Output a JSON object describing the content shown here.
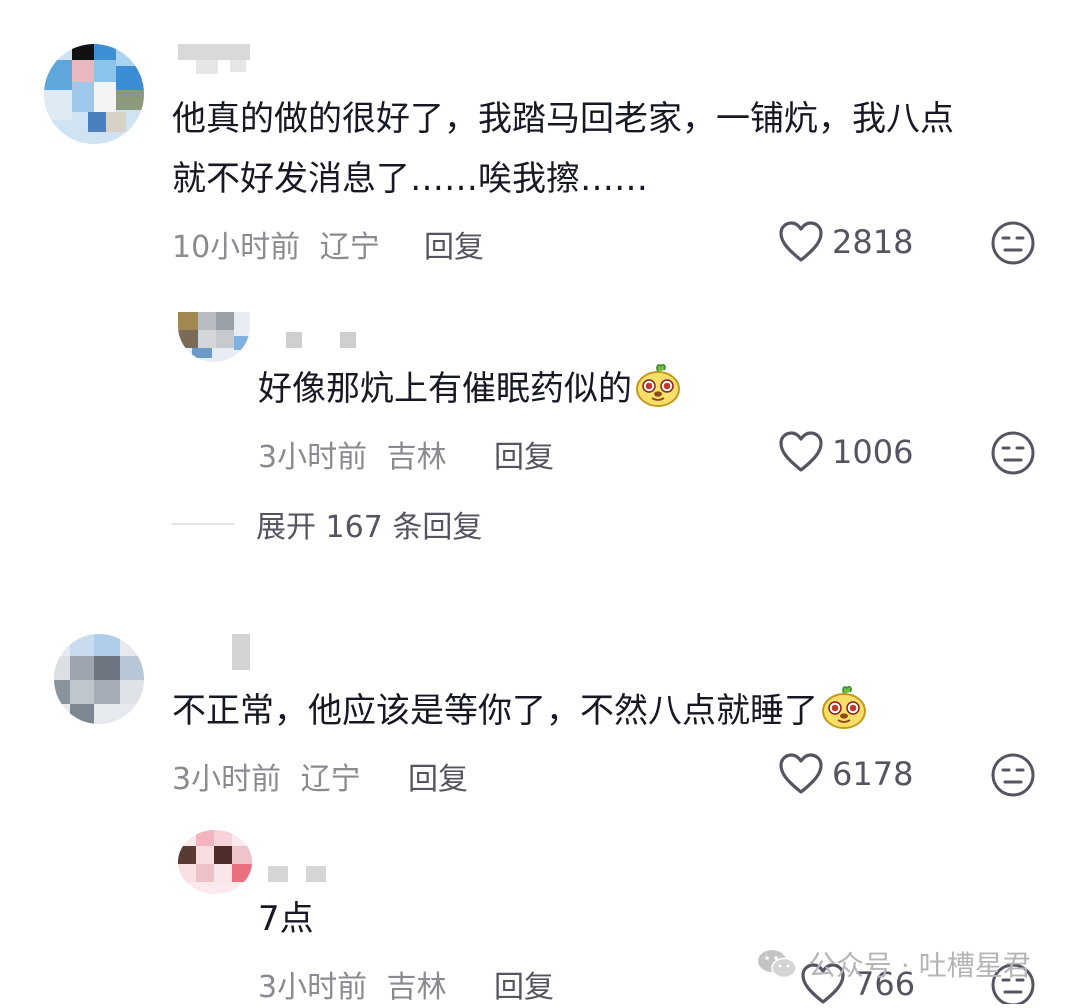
{
  "comments": [
    {
      "text_line1": "他真的做的很好了，我踏马回老家，一铺炕，我八点",
      "text_line2": "就不好发消息了……唉我擦……",
      "time": "10小时前",
      "location": "辽宁",
      "reply_label": "回复",
      "likes": "2818",
      "replies": [
        {
          "text": "好像那炕上有催眠药似的",
          "emoji": "sly-face-emoji",
          "time": "3小时前",
          "location": "吉林",
          "reply_label": "回复",
          "likes": "1006"
        }
      ],
      "expand_label": "展开 167 条回复"
    },
    {
      "text": "不正常，他应该是等你了，不然八点就睡了",
      "emoji": "sly-face-emoji",
      "time": "3小时前",
      "location": "辽宁",
      "reply_label": "回复",
      "likes": "6178",
      "replies": [
        {
          "text": "7点",
          "time": "3小时前",
          "location": "吉林",
          "reply_label": "回复",
          "likes": "766"
        }
      ]
    }
  ],
  "watermark": {
    "text": "公众号 · 吐槽星君",
    "icon": "wechat-icon"
  },
  "icons": {
    "like": "heart-outline-icon",
    "dislike": "meh-face-icon"
  },
  "colors": {
    "text": "#161823",
    "meta": "#8a8b91",
    "action": "#545561",
    "icon": "#545561"
  }
}
